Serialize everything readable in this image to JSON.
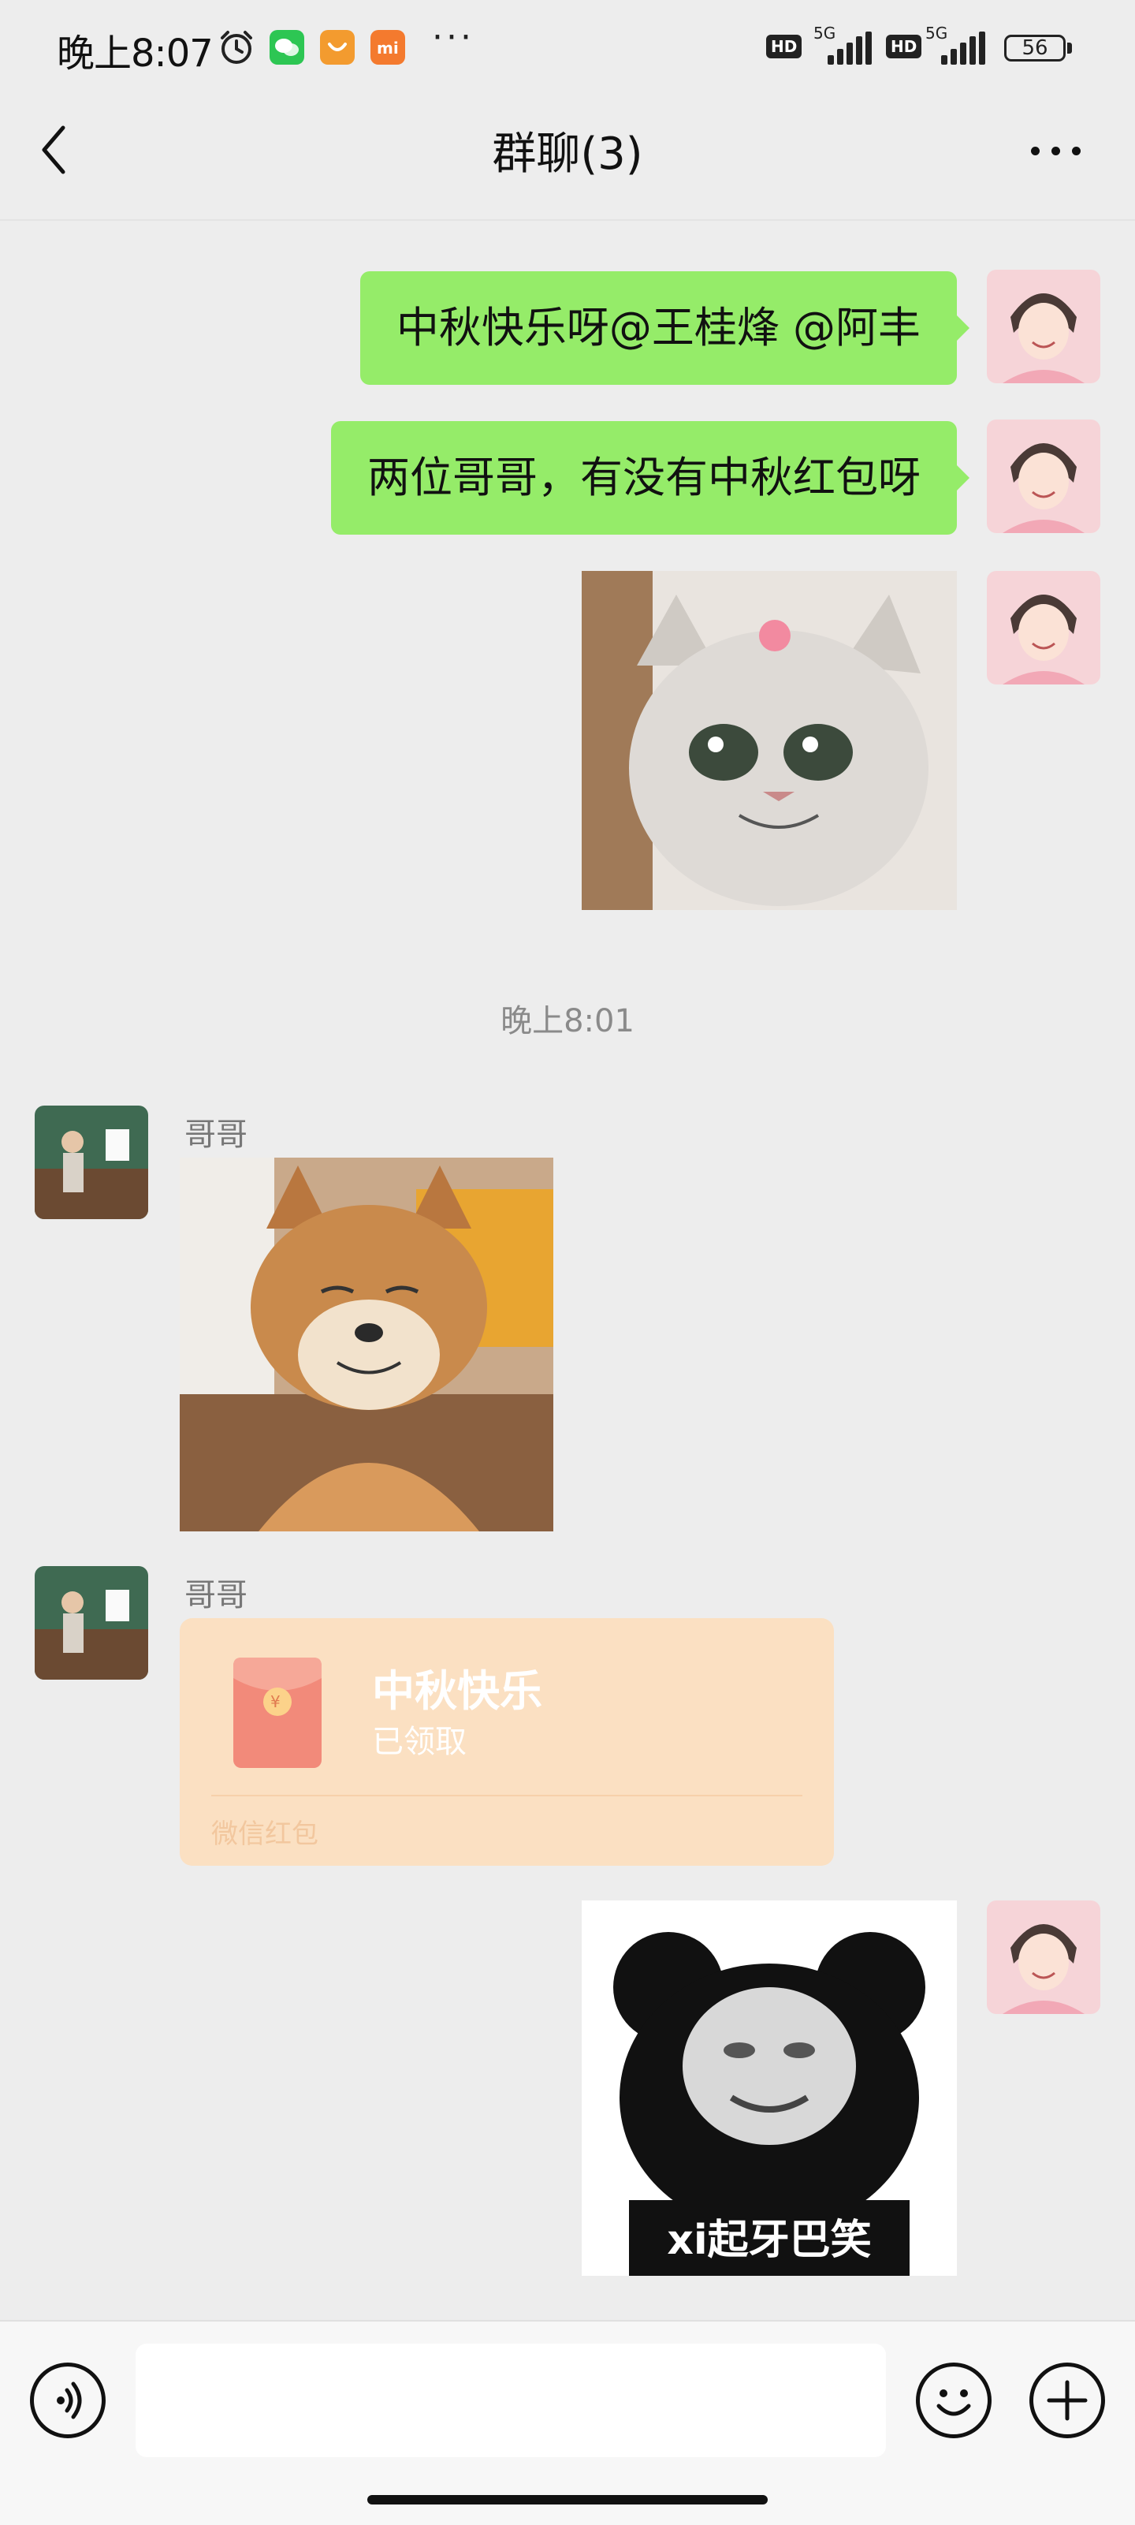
{
  "status_bar": {
    "time": "晚上8:07",
    "notification_icons": [
      "alarm-icon",
      "wechat-icon",
      "taobao-icon",
      "mi-icon"
    ],
    "more": "···",
    "sim1": {
      "badge": "HD",
      "network": "5G"
    },
    "sim2": {
      "badge": "HD",
      "network": "5G"
    },
    "battery": "56"
  },
  "header": {
    "title": "群聊(3)"
  },
  "messages": [
    {
      "sender": "me",
      "type": "text",
      "text": "中秋快乐呀@王桂烽  @阿丰"
    },
    {
      "sender": "me",
      "type": "text",
      "text": "两位哥哥，有没有中秋红包呀"
    },
    {
      "sender": "me",
      "type": "sticker",
      "sticker": "smiling-cat-sticker"
    },
    {
      "type": "timestamp",
      "text": "晚上8:01"
    },
    {
      "sender": "哥哥",
      "type": "sticker",
      "sticker": "smiling-shiba-sticker"
    },
    {
      "sender": "哥哥",
      "type": "red_packet",
      "title": "中秋快乐",
      "status": "已领取",
      "footer": "微信红包"
    },
    {
      "sender": "me",
      "type": "sticker",
      "sticker": "panda-meme-sticker",
      "caption": "xi起牙巴笑"
    }
  ],
  "input_bar": {
    "placeholder": "",
    "value": ""
  },
  "colors": {
    "background": "#ededed",
    "my_bubble": "#95ec69",
    "red_packet_claimed": "#fbe0c2"
  }
}
